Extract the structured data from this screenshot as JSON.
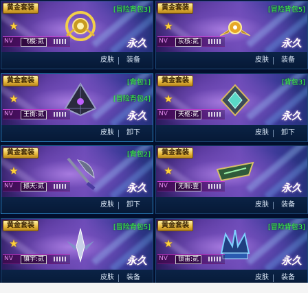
{
  "cards": [
    {
      "badge": "黄金套装",
      "tag": "[冒险背包3]",
      "tag2": "",
      "tier_level": "NV",
      "tier_name": "飞梭:贰",
      "forever": "永久",
      "skin_label": "皮肤",
      "action_label": "装备",
      "icon": "golden-gear-icon",
      "selected": false
    },
    {
      "badge": "黄金套装",
      "tag": "[冒险背包5]",
      "tag2": "",
      "tier_level": "NV",
      "tier_name": "灰核:贰",
      "forever": "永久",
      "skin_label": "皮肤",
      "action_label": "装备",
      "icon": "gold-wing-core-icon",
      "selected": false
    },
    {
      "badge": "黄金套装",
      "tag": "[背包1]",
      "tag2": "[冒险背包4]",
      "tier_level": "NV",
      "tier_name": "王衡:贰",
      "forever": "永久",
      "skin_label": "皮肤",
      "action_label": "卸下",
      "icon": "dark-pyramid-icon",
      "selected": true
    },
    {
      "badge": "黄金套装",
      "tag": "[背包3]",
      "tag2": "",
      "tier_level": "NV",
      "tier_name": "天枢:贰",
      "forever": "永久",
      "skin_label": "皮肤",
      "action_label": "卸下",
      "icon": "diamond-crest-icon",
      "selected": false
    },
    {
      "badge": "黄金套装",
      "tag": "[背包2]",
      "tag2": "",
      "tier_level": "NV",
      "tier_name": "撼天:贰",
      "forever": "永久",
      "skin_label": "皮肤",
      "action_label": "卸下",
      "icon": "battle-axe-icon",
      "selected": true
    },
    {
      "badge": "黄金套装",
      "tag": "",
      "tag2": "",
      "tier_level": "NV",
      "tier_name": "无暇:壹",
      "forever": "永久",
      "skin_label": "皮肤",
      "action_label": "装备",
      "icon": "jade-blade-icon",
      "selected": false
    },
    {
      "badge": "黄金套装",
      "tag": "[冒险背包5]",
      "tag2": "",
      "tier_level": "NV",
      "tier_name": "镇宇:贰",
      "forever": "永久",
      "skin_label": "皮肤",
      "action_label": "装备",
      "icon": "winged-blade-icon",
      "selected": false
    },
    {
      "badge": "黄金套装",
      "tag": "[冒险背包3]",
      "tag2": "",
      "tier_level": "NV",
      "tier_name": "锁宙:贰",
      "forever": "永久",
      "skin_label": "皮肤",
      "action_label": "装备",
      "icon": "crystal-crown-icon",
      "selected": false
    }
  ]
}
